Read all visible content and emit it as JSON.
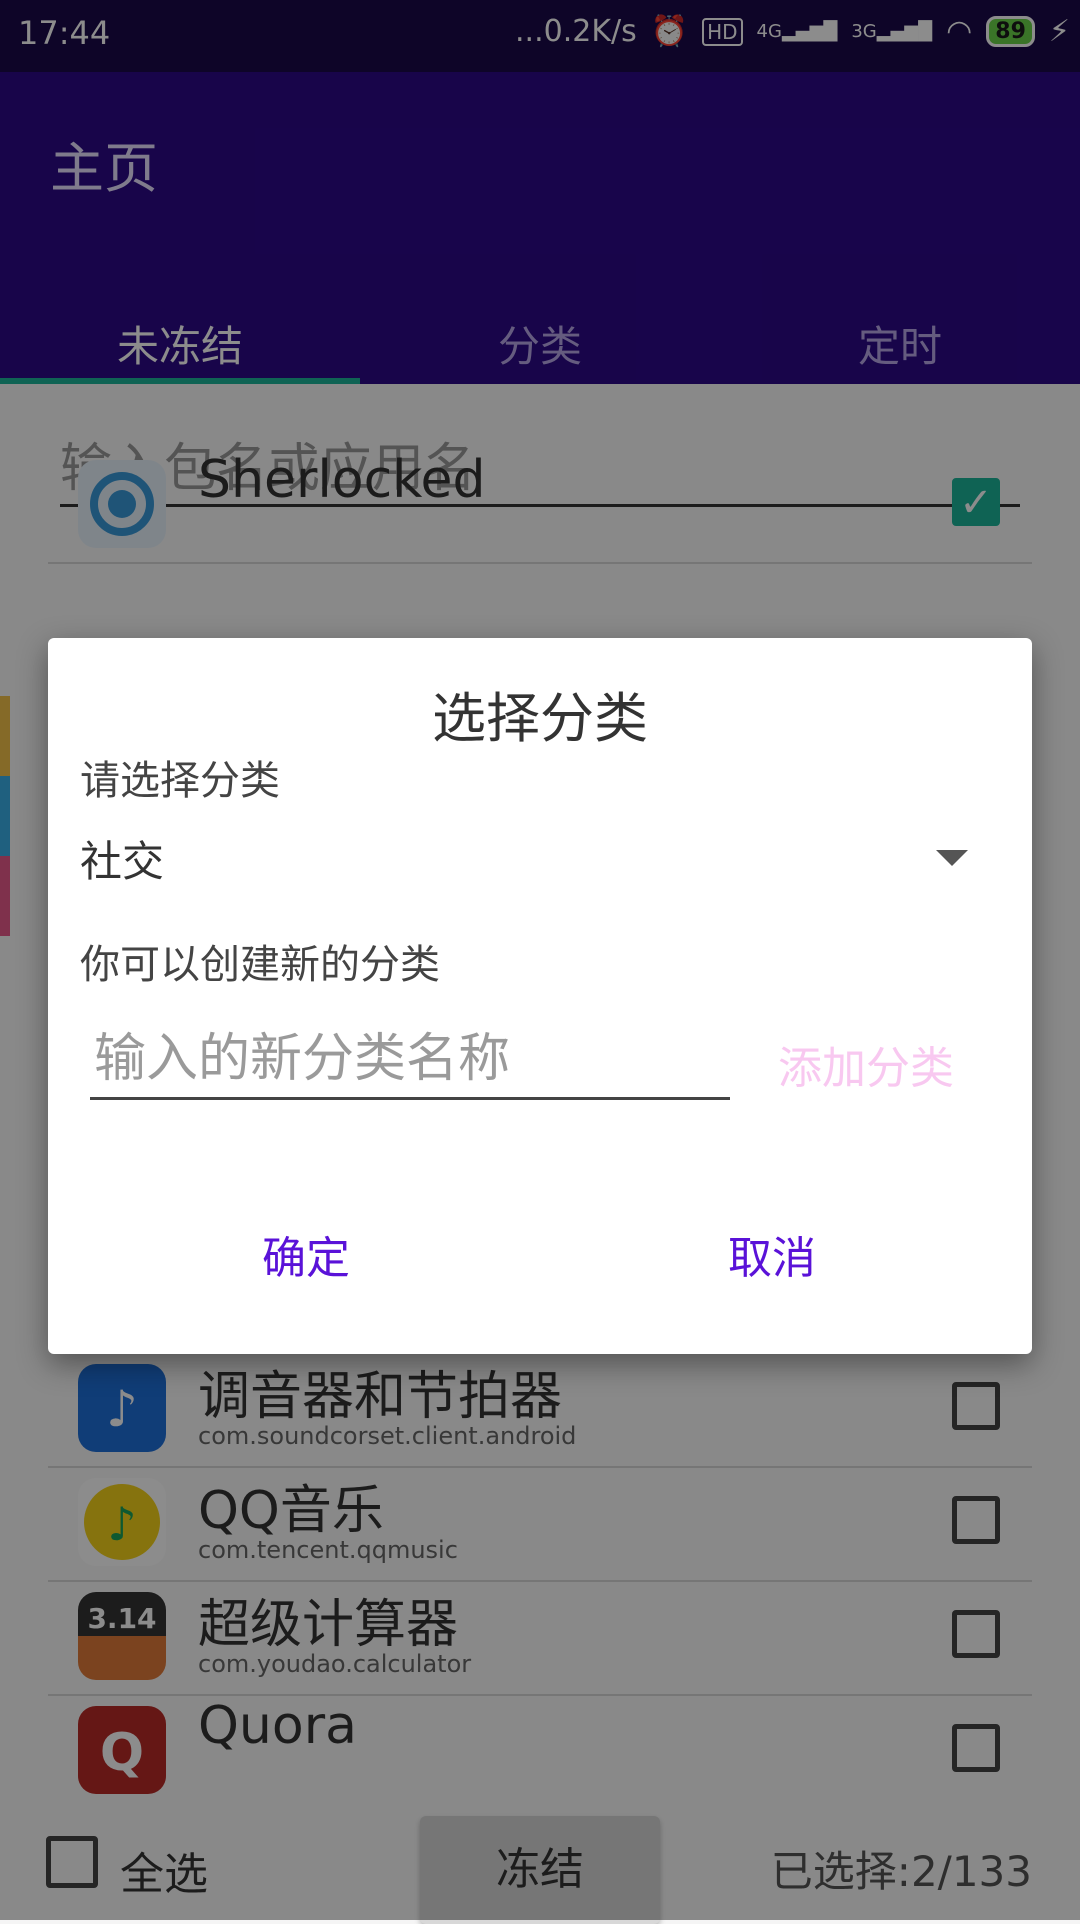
{
  "status_bar": {
    "time": "17:44",
    "network_speed": "...0.2K/s",
    "hd": "HD",
    "net_4g": "4G",
    "net_3g": "3G",
    "battery": "89"
  },
  "app_bar": {
    "title": "主页"
  },
  "tabs": [
    {
      "label": "未冻结",
      "active": true
    },
    {
      "label": "分类",
      "active": false
    },
    {
      "label": "定时",
      "active": false
    }
  ],
  "search": {
    "placeholder": "输入包名或应用名"
  },
  "apps": [
    {
      "name": "Sherlocked",
      "package": "",
      "checked": true,
      "icon": "sherlocked-icon",
      "icon_color": "#3a9ad9"
    },
    {
      "name": "调音器和节拍器",
      "package": "com.soundcorset.client.android",
      "checked": false,
      "icon": "music-note-icon",
      "icon_color": "#1e6fd9"
    },
    {
      "name": "QQ音乐",
      "package": "com.tencent.qqmusic",
      "checked": false,
      "icon": "qqmusic-icon",
      "icon_color": "#f5d21b"
    },
    {
      "name": "超级计算器",
      "package": "com.youdao.calculator",
      "checked": false,
      "icon": "calculator-icon",
      "icon_color": "#e07b3a"
    },
    {
      "name": "Quora",
      "package": "",
      "checked": false,
      "icon": "quora-icon",
      "icon_color": "#b92b27"
    }
  ],
  "bottom_bar": {
    "select_all_label": "全选",
    "freeze_label": "冻结",
    "selected_count": "已选择:2/133"
  },
  "dialog": {
    "title": "选择分类",
    "prompt": "请选择分类",
    "selected_category": "社交",
    "create_hint": "你可以创建新的分类",
    "new_category_placeholder": "输入的新分类名称",
    "add_label": "添加分类",
    "ok_label": "确定",
    "cancel_label": "取消"
  }
}
